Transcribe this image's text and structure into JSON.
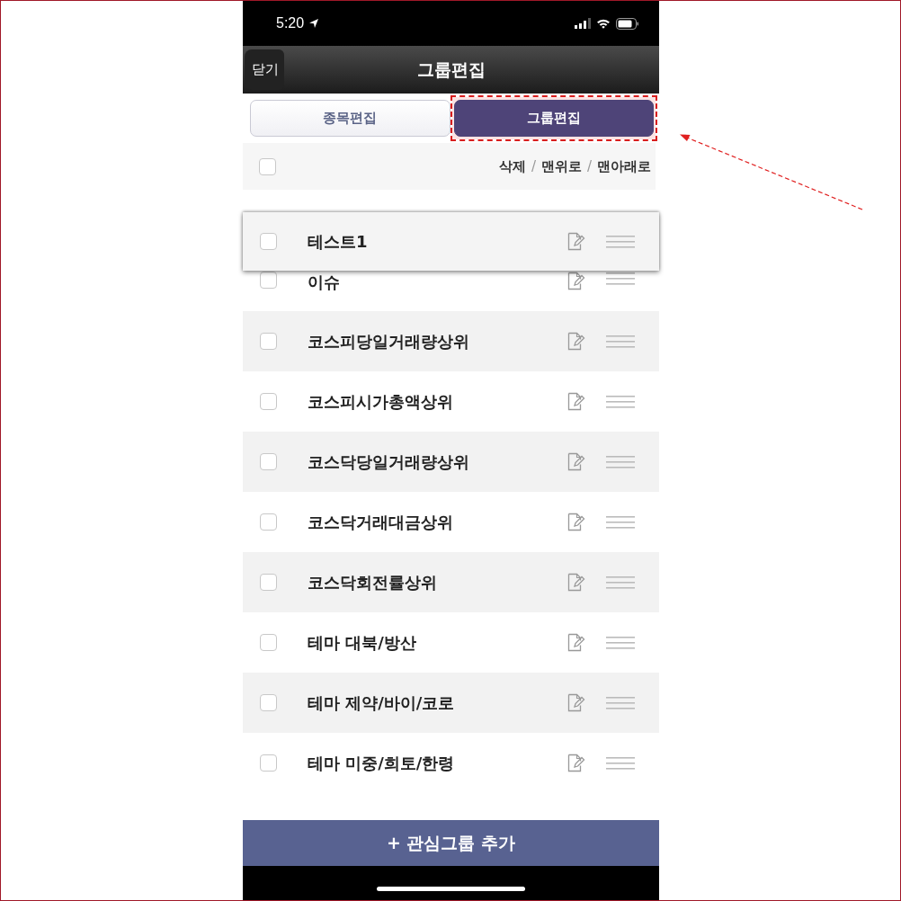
{
  "status_bar": {
    "time": "5:20"
  },
  "nav": {
    "back_label": "닫기",
    "title": "그룹편집"
  },
  "tabs": [
    {
      "label": "종목편집",
      "selected": false
    },
    {
      "label": "그룹편집",
      "selected": true,
      "highlighted": true
    }
  ],
  "toolbar": {
    "select_all_checked": false,
    "items": [
      {
        "kind": "action",
        "text": "삭제"
      },
      {
        "kind": "separator",
        "text": "/"
      },
      {
        "kind": "action",
        "text": "맨위로"
      },
      {
        "kind": "separator",
        "text": "/"
      },
      {
        "kind": "action",
        "text": "맨아래로"
      }
    ]
  },
  "groups": [
    {
      "name": "테스트1",
      "checked": false,
      "dragging": true
    },
    {
      "name": "이슈",
      "checked": false,
      "dragging": false
    },
    {
      "name": "코스피당일거래량상위",
      "checked": false,
      "dragging": false
    },
    {
      "name": "코스피시가총액상위",
      "checked": false,
      "dragging": false
    },
    {
      "name": "코스닥당일거래량상위",
      "checked": false,
      "dragging": false
    },
    {
      "name": "코스닥거래대금상위",
      "checked": false,
      "dragging": false
    },
    {
      "name": "코스닥회전률상위",
      "checked": false,
      "dragging": false
    },
    {
      "name": "테마 대북/방산",
      "checked": false,
      "dragging": false
    },
    {
      "name": "테마 제약/바이/코로",
      "checked": false,
      "dragging": false
    },
    {
      "name": "테마 미중/희토/한령",
      "checked": false,
      "dragging": false
    }
  ],
  "add_button": {
    "label": "+ 관심그룹 추가"
  },
  "annotations": [
    {
      "kind": "arrow"
    }
  ]
}
